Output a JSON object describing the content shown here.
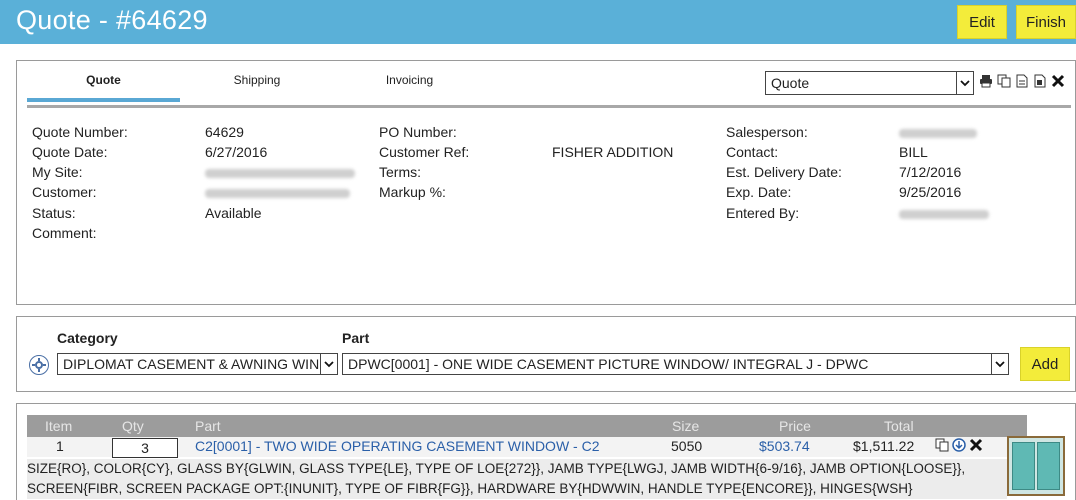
{
  "header": {
    "title": "Quote - #64629",
    "edit_label": "Edit",
    "finish_label": "Finish"
  },
  "tabs": [
    {
      "label": "Quote",
      "active": true
    },
    {
      "label": "Shipping",
      "active": false
    },
    {
      "label": "Invoicing",
      "active": false
    }
  ],
  "view_select": {
    "value": "Quote"
  },
  "toolbar_icons": [
    "print-icon",
    "copy-icon",
    "document-icon",
    "document-alt-icon",
    "delete-icon"
  ],
  "details": {
    "quote_number_label": "Quote Number:",
    "quote_number": "64629",
    "quote_date_label": "Quote Date:",
    "quote_date": "6/27/2016",
    "my_site_label": "My Site:",
    "customer_label": "Customer:",
    "status_label": "Status:",
    "status": "Available",
    "comment_label": "Comment:",
    "po_number_label": "PO Number:",
    "customer_ref_label": "Customer Ref:",
    "customer_ref": "FISHER ADDITION",
    "terms_label": "Terms:",
    "markup_label": "Markup %:",
    "salesperson_label": "Salesperson:",
    "contact_label": "Contact:",
    "contact": "BILL",
    "est_delivery_label": "Est. Delivery Date:",
    "est_delivery": "7/12/2016",
    "exp_date_label": "Exp. Date:",
    "exp_date": "9/25/2016",
    "entered_by_label": "Entered By:"
  },
  "add_part": {
    "category_label": "Category",
    "part_label": "Part",
    "category_value": "DIPLOMAT CASEMENT & AWNING WIN",
    "part_value": "DPWC[0001] - ONE WIDE CASEMENT PICTURE WINDOW/ INTEGRAL J - DPWC",
    "add_label": "Add"
  },
  "items_table": {
    "columns": [
      "Item",
      "Qty",
      "Part",
      "Size",
      "Price",
      "Total"
    ],
    "rows": [
      {
        "item": "1",
        "qty": "3",
        "part": "C2[0001] - TWO WIDE OPERATING CASEMENT WINDOW - C2",
        "size": "5050",
        "price": "$503.74",
        "total": "$1,511.22",
        "options": "SIZE{RO}, COLOR{CY}, GLASS BY{GLWIN, GLASS TYPE{LE}, TYPE OF LOE{272}}, JAMB TYPE{LWGJ, JAMB WIDTH{6-9/16}, JAMB OPTION{LOOSE}}, SCREEN{FIBR, SCREEN PACKAGE OPT:{INUNIT}, TYPE OF FIBR{FG}}, HARDWARE BY{HDWWIN, HANDLE TYPE{ENCORE}}, HINGES{WSH}"
      }
    ]
  }
}
